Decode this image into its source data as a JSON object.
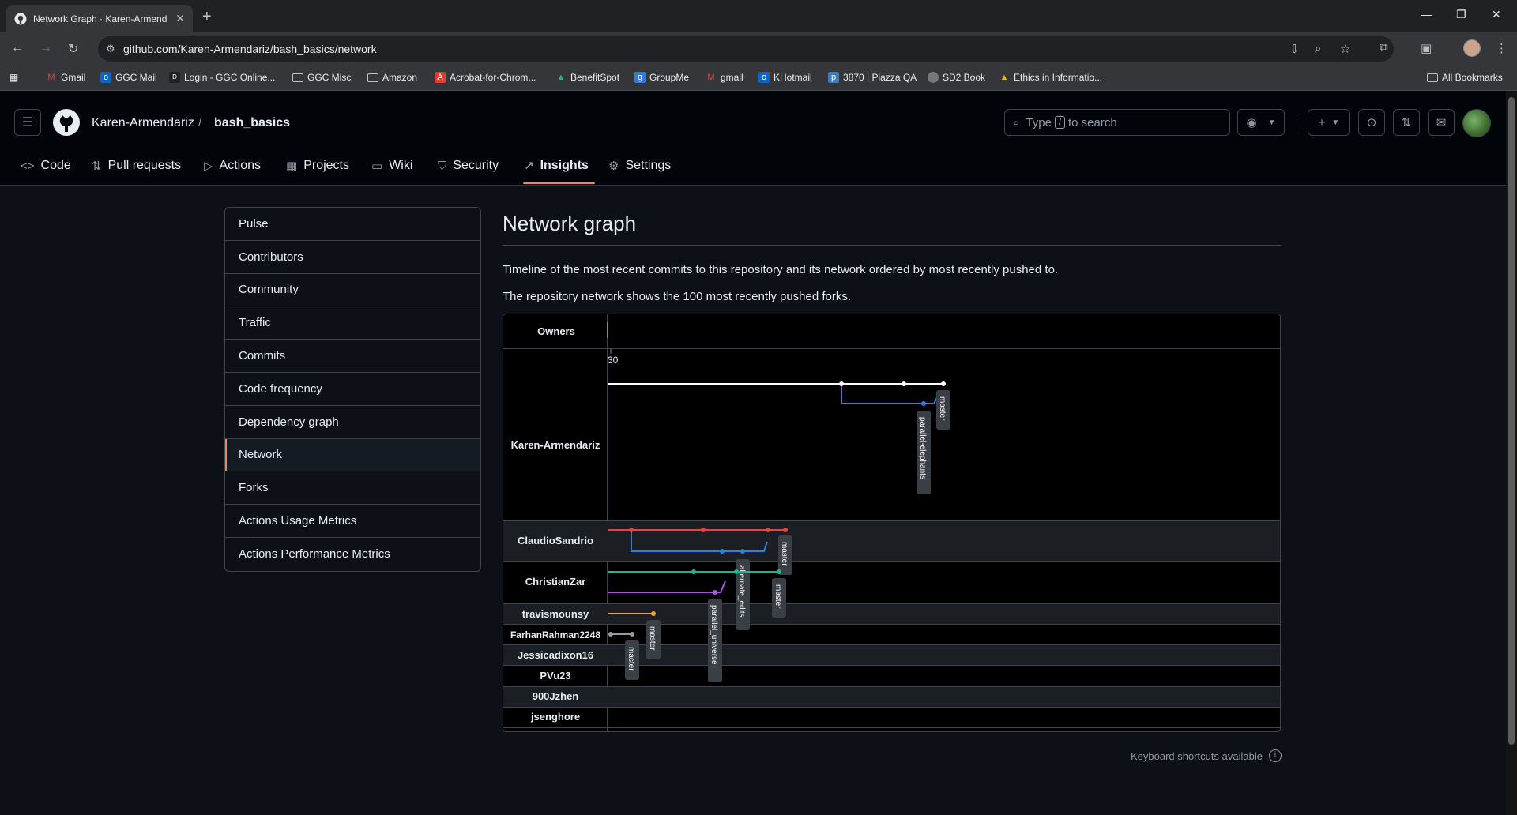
{
  "browser": {
    "tab_title": "Network Graph · Karen-Armend",
    "url": "github.com/Karen-Armendariz/bash_basics/network",
    "bookmarks": [
      "Gmail",
      "GGC Mail",
      "Login - GGC Online...",
      "GGC Misc",
      "Amazon",
      "Acrobat-for-Chrom...",
      "BenefitSpot",
      "GroupMe",
      "gmail",
      "KHotmail",
      "3870 | Piazza QA",
      "SD2 Book",
      "Ethics in Informatio..."
    ],
    "all_bookmarks": "All Bookmarks"
  },
  "header": {
    "owner": "Karen-Armendariz",
    "separator": "/",
    "repo": "bash_basics",
    "search_prefix": "Type",
    "search_key": "/",
    "search_suffix": "to search"
  },
  "repo_nav": {
    "tabs": [
      {
        "label": "Code"
      },
      {
        "label": "Pull requests"
      },
      {
        "label": "Actions"
      },
      {
        "label": "Projects"
      },
      {
        "label": "Wiki"
      },
      {
        "label": "Security"
      },
      {
        "label": "Insights"
      },
      {
        "label": "Settings"
      }
    ],
    "active": "Insights"
  },
  "sidebar": {
    "items": [
      {
        "label": "Pulse"
      },
      {
        "label": "Contributors"
      },
      {
        "label": "Community"
      },
      {
        "label": "Traffic"
      },
      {
        "label": "Commits"
      },
      {
        "label": "Code frequency"
      },
      {
        "label": "Dependency graph"
      },
      {
        "label": "Network"
      },
      {
        "label": "Forks"
      },
      {
        "label": "Actions Usage Metrics"
      },
      {
        "label": "Actions Performance Metrics"
      }
    ],
    "active": "Network"
  },
  "main": {
    "title": "Network graph",
    "desc1": "Timeline of the most recent commits to this repository and its network ordered by most recently pushed to.",
    "desc2": "The repository network shows the 100 most recently pushed forks.",
    "owners_header": "Owners",
    "timeline_label": "30",
    "keyboard_note": "Keyboard shortcuts available"
  },
  "network": {
    "owners": [
      "Karen-Armendariz",
      "ClaudioSandrio",
      "ChristianZar",
      "travismounsy",
      "FarhanRahman2248",
      "Jessicadixon16",
      "PVu23",
      "900Jzhen",
      "jsenghore"
    ],
    "branch_labels": [
      {
        "text": "master",
        "owner": "Karen-Armendariz"
      },
      {
        "text": "parallel-elephants",
        "owner": "Karen-Armendariz"
      },
      {
        "text": "master",
        "owner": "ClaudioSandrio"
      },
      {
        "text": "alternate_edits",
        "owner": "ClaudioSandrio"
      },
      {
        "text": "master",
        "owner": "ChristianZar"
      },
      {
        "text": "parallel_universe",
        "owner": "ChristianZar"
      },
      {
        "text": "master",
        "owner": "travismounsy"
      },
      {
        "text": "master",
        "owner": "FarhanRahman2248"
      }
    ],
    "colors": {
      "white": "#ffffff",
      "blue": "#2f82d6",
      "red": "#e0473d",
      "teal": "#26b090",
      "purple": "#a55bd6",
      "orange": "#f2a33a",
      "gray": "#9a9a9a"
    }
  }
}
